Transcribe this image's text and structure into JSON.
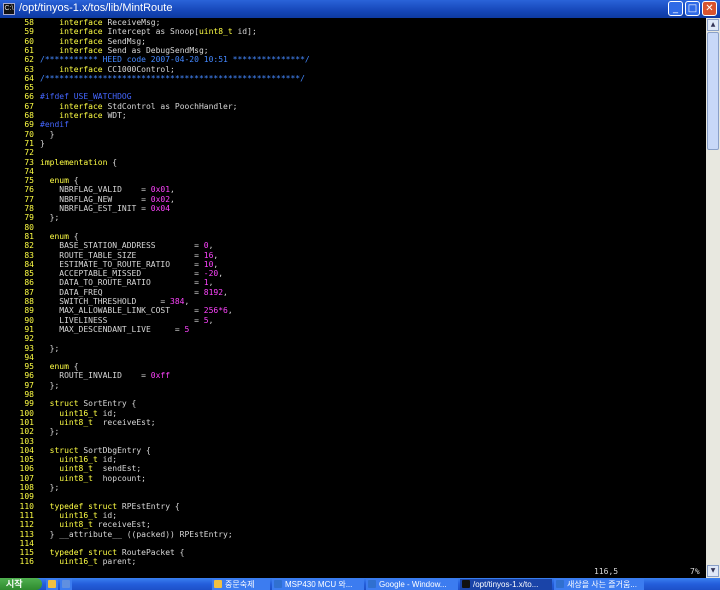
{
  "window": {
    "title": "/opt/tinyos-1.x/tos/lib/MintRoute",
    "minimize_label": "_",
    "maximize_label": "□",
    "close_label": "✕"
  },
  "code_lines": [
    {
      "n": "58",
      "t": [
        {
          "k": "kw",
          "s": "    interface"
        },
        {
          "k": "tx",
          "s": " ReceiveMsg;"
        }
      ]
    },
    {
      "n": "59",
      "t": [
        {
          "k": "kw",
          "s": "    interface"
        },
        {
          "k": "tx",
          "s": " Intercept as Snoop["
        },
        {
          "k": "tp",
          "s": "uint8_t"
        },
        {
          "k": "tx",
          "s": " id];"
        }
      ]
    },
    {
      "n": "60",
      "t": [
        {
          "k": "kw",
          "s": "    interface"
        },
        {
          "k": "tx",
          "s": " SendMsg;"
        }
      ]
    },
    {
      "n": "61",
      "t": [
        {
          "k": "kw",
          "s": "    interface"
        },
        {
          "k": "tx",
          "s": " Send as DebugSendMsg;"
        }
      ]
    },
    {
      "n": "62",
      "t": [
        {
          "k": "cm",
          "s": "/*********** HEED code 2007-04-20 10:51 ***************/"
        }
      ]
    },
    {
      "n": "63",
      "t": [
        {
          "k": "kw",
          "s": "    interface"
        },
        {
          "k": "tx",
          "s": " CC1000Control;"
        }
      ]
    },
    {
      "n": "64",
      "t": [
        {
          "k": "cm",
          "s": "/*****************************************************/"
        }
      ]
    },
    {
      "n": "65",
      "t": []
    },
    {
      "n": "66",
      "t": [
        {
          "k": "pp",
          "s": "#ifdef USE_WATCHDOG"
        }
      ]
    },
    {
      "n": "67",
      "t": [
        {
          "k": "kw",
          "s": "    interface"
        },
        {
          "k": "tx",
          "s": " StdControl as PoochHandler;"
        }
      ]
    },
    {
      "n": "68",
      "t": [
        {
          "k": "kw",
          "s": "    interface"
        },
        {
          "k": "tx",
          "s": " WDT;"
        }
      ]
    },
    {
      "n": "69",
      "t": [
        {
          "k": "pp",
          "s": "#endif"
        }
      ]
    },
    {
      "n": "70",
      "t": [
        {
          "k": "tx",
          "s": "  }"
        }
      ]
    },
    {
      "n": "71",
      "t": [
        {
          "k": "tx",
          "s": "}"
        }
      ]
    },
    {
      "n": "72",
      "t": []
    },
    {
      "n": "73",
      "t": [
        {
          "k": "kw",
          "s": "implementation"
        },
        {
          "k": "tx",
          "s": " {"
        }
      ]
    },
    {
      "n": "74",
      "t": []
    },
    {
      "n": "75",
      "t": [
        {
          "k": "kw",
          "s": "  enum"
        },
        {
          "k": "tx",
          "s": " {"
        }
      ]
    },
    {
      "n": "76",
      "t": [
        {
          "k": "tx",
          "s": "    NBRFLAG_VALID    = "
        },
        {
          "k": "nm",
          "s": "0x01"
        },
        {
          "k": "tx",
          "s": ","
        }
      ]
    },
    {
      "n": "77",
      "t": [
        {
          "k": "tx",
          "s": "    NBRFLAG_NEW      = "
        },
        {
          "k": "nm",
          "s": "0x02"
        },
        {
          "k": "tx",
          "s": ","
        }
      ]
    },
    {
      "n": "78",
      "t": [
        {
          "k": "tx",
          "s": "    NBRFLAG_EST_INIT = "
        },
        {
          "k": "nm",
          "s": "0x04"
        }
      ]
    },
    {
      "n": "79",
      "t": [
        {
          "k": "tx",
          "s": "  };"
        }
      ]
    },
    {
      "n": "80",
      "t": []
    },
    {
      "n": "81",
      "t": [
        {
          "k": "kw",
          "s": "  enum"
        },
        {
          "k": "tx",
          "s": " {"
        }
      ]
    },
    {
      "n": "82",
      "t": [
        {
          "k": "tx",
          "s": "    BASE_STATION_ADDRESS        = "
        },
        {
          "k": "nm",
          "s": "0"
        },
        {
          "k": "tx",
          "s": ","
        }
      ]
    },
    {
      "n": "83",
      "t": [
        {
          "k": "tx",
          "s": "    ROUTE_TABLE_SIZE            = "
        },
        {
          "k": "nm",
          "s": "16"
        },
        {
          "k": "tx",
          "s": ","
        }
      ]
    },
    {
      "n": "84",
      "t": [
        {
          "k": "tx",
          "s": "    ESTIMATE_TO_ROUTE_RATIO     = "
        },
        {
          "k": "nm",
          "s": "10"
        },
        {
          "k": "tx",
          "s": ","
        }
      ]
    },
    {
      "n": "85",
      "t": [
        {
          "k": "tx",
          "s": "    ACCEPTABLE_MISSED           = "
        },
        {
          "k": "nm",
          "s": "-20"
        },
        {
          "k": "tx",
          "s": ","
        }
      ]
    },
    {
      "n": "86",
      "t": [
        {
          "k": "tx",
          "s": "    DATA_TO_ROUTE_RATIO         = "
        },
        {
          "k": "nm",
          "s": "1"
        },
        {
          "k": "tx",
          "s": ","
        }
      ]
    },
    {
      "n": "87",
      "t": [
        {
          "k": "tx",
          "s": "    DATA_FREQ                   = "
        },
        {
          "k": "nm",
          "s": "8192"
        },
        {
          "k": "tx",
          "s": ","
        }
      ]
    },
    {
      "n": "88",
      "t": [
        {
          "k": "tx",
          "s": "    SWITCH_THRESHOLD     = "
        },
        {
          "k": "nm",
          "s": "384"
        },
        {
          "k": "tx",
          "s": ","
        }
      ]
    },
    {
      "n": "89",
      "t": [
        {
          "k": "tx",
          "s": "    MAX_ALLOWABLE_LINK_COST     = "
        },
        {
          "k": "nm",
          "s": "256*6"
        },
        {
          "k": "tx",
          "s": ","
        }
      ]
    },
    {
      "n": "90",
      "t": [
        {
          "k": "tx",
          "s": "    LIVELINESS                  = "
        },
        {
          "k": "nm",
          "s": "5"
        },
        {
          "k": "tx",
          "s": ","
        }
      ]
    },
    {
      "n": "91",
      "t": [
        {
          "k": "tx",
          "s": "    MAX_DESCENDANT_LIVE     = "
        },
        {
          "k": "nm",
          "s": "5"
        }
      ]
    },
    {
      "n": "92",
      "t": []
    },
    {
      "n": "93",
      "t": [
        {
          "k": "tx",
          "s": "  };"
        }
      ]
    },
    {
      "n": "94",
      "t": []
    },
    {
      "n": "95",
      "t": [
        {
          "k": "kw",
          "s": "  enum"
        },
        {
          "k": "tx",
          "s": " {"
        }
      ]
    },
    {
      "n": "96",
      "t": [
        {
          "k": "tx",
          "s": "    ROUTE_INVALID    = "
        },
        {
          "k": "nm",
          "s": "0xff"
        }
      ]
    },
    {
      "n": "97",
      "t": [
        {
          "k": "tx",
          "s": "  };"
        }
      ]
    },
    {
      "n": "98",
      "t": []
    },
    {
      "n": "99",
      "t": [
        {
          "k": "kw",
          "s": "  struct"
        },
        {
          "k": "tx",
          "s": " SortEntry {"
        }
      ]
    },
    {
      "n": "100",
      "t": [
        {
          "k": "tp",
          "s": "    uint16_t"
        },
        {
          "k": "tx",
          "s": " id;"
        }
      ]
    },
    {
      "n": "101",
      "t": [
        {
          "k": "tp",
          "s": "    uint8_t"
        },
        {
          "k": "tx",
          "s": "  receiveEst;"
        }
      ]
    },
    {
      "n": "102",
      "t": [
        {
          "k": "tx",
          "s": "  };"
        }
      ]
    },
    {
      "n": "103",
      "t": []
    },
    {
      "n": "104",
      "t": [
        {
          "k": "kw",
          "s": "  struct"
        },
        {
          "k": "tx",
          "s": " SortDbgEntry {"
        }
      ]
    },
    {
      "n": "105",
      "t": [
        {
          "k": "tp",
          "s": "    uint16_t"
        },
        {
          "k": "tx",
          "s": " id;"
        }
      ]
    },
    {
      "n": "106",
      "t": [
        {
          "k": "tp",
          "s": "    uint8_t"
        },
        {
          "k": "tx",
          "s": "  sendEst;"
        }
      ]
    },
    {
      "n": "107",
      "t": [
        {
          "k": "tp",
          "s": "    uint8_t"
        },
        {
          "k": "tx",
          "s": "  hopcount;"
        }
      ]
    },
    {
      "n": "108",
      "t": [
        {
          "k": "tx",
          "s": "  };"
        }
      ]
    },
    {
      "n": "109",
      "t": []
    },
    {
      "n": "110",
      "t": [
        {
          "k": "kw",
          "s": "  typedef struct"
        },
        {
          "k": "tx",
          "s": " RPEstEntry {"
        }
      ]
    },
    {
      "n": "111",
      "t": [
        {
          "k": "tp",
          "s": "    uint16_t"
        },
        {
          "k": "tx",
          "s": " id;"
        }
      ]
    },
    {
      "n": "112",
      "t": [
        {
          "k": "tp",
          "s": "    uint8_t"
        },
        {
          "k": "tx",
          "s": " receiveEst;"
        }
      ]
    },
    {
      "n": "113",
      "t": [
        {
          "k": "tx",
          "s": "  } __attribute__ ((packed)) RPEstEntry;"
        }
      ]
    },
    {
      "n": "114",
      "t": []
    },
    {
      "n": "115",
      "t": [
        {
          "k": "kw",
          "s": "  typedef struct"
        },
        {
          "k": "tx",
          "s": " RoutePacket {"
        }
      ]
    },
    {
      "n": "116",
      "t": [
        {
          "k": "tp",
          "s": "    uint16_t"
        },
        {
          "k": "tx",
          "s": " parent;"
        }
      ]
    }
  ],
  "status": {
    "position": "116,5",
    "percent": "7%"
  },
  "taskbar": {
    "start_label": "시작",
    "items": [
      {
        "label": "",
        "icon_color": "#f0c040",
        "active": false
      },
      {
        "label": "",
        "icon_color": "#6090e0",
        "active": false
      },
      {
        "label": "중문숙제",
        "icon_color": "#f0c040",
        "active": false
      },
      {
        "label": "MSP430 MCU 와...",
        "icon_color": "#3070d0",
        "active": false
      },
      {
        "label": "Google - Window...",
        "icon_color": "#3070d0",
        "active": false
      },
      {
        "label": "/opt/tinyos-1.x/to...",
        "icon_color": "#111111",
        "active": true
      },
      {
        "label": "새상을 사는 즐거움...",
        "icon_color": "#3070d0",
        "active": false
      }
    ]
  }
}
